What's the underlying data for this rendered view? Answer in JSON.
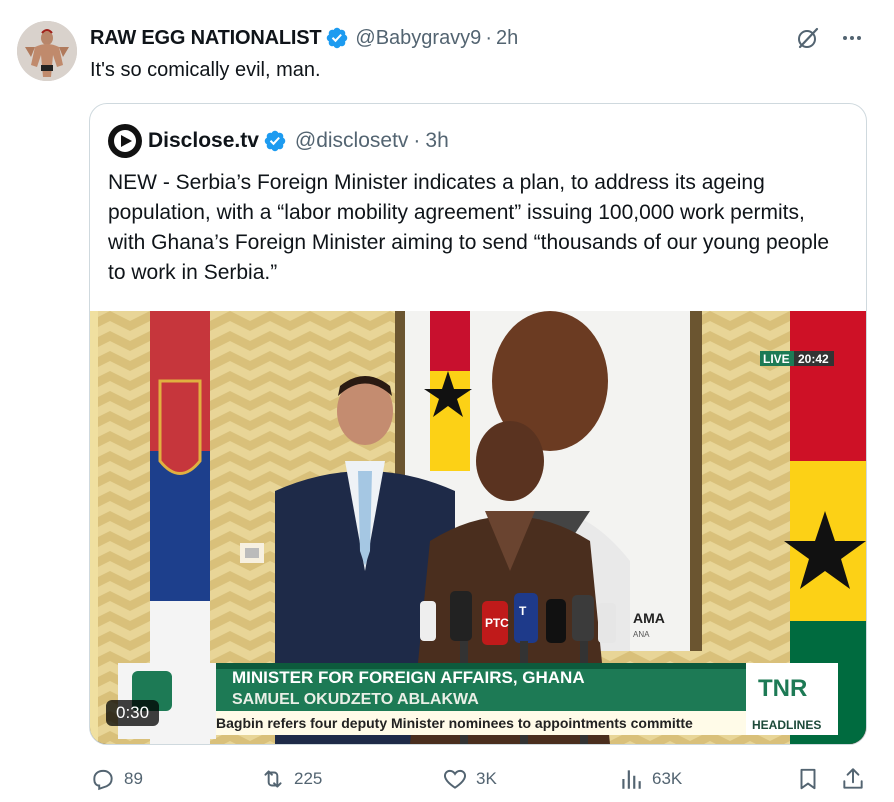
{
  "author": {
    "display_name": "RAW EGG NATIONALIST",
    "handle": "@Babygravy9",
    "separator": "·",
    "time": "2h",
    "text": "It's so comically evil, man.",
    "avatar_icon": "bodybuilder-avatar-icon",
    "verified_icon": "verified-badge-icon"
  },
  "top_actions": {
    "grok_icon": "grok-slash-icon",
    "more_icon": "more-dots-icon"
  },
  "quoted": {
    "display_name": "Disclose.tv",
    "handle": "@disclosetv",
    "separator": "·",
    "time": "3h",
    "text": "NEW - Serbia’s Foreign Minister indicates a plan, to address its ageing population, with a “labor mobility agreement” issuing 100,000 work permits, with Ghana’s Foreign Minister aiming to send “thousands of our young people to work in Serbia.”",
    "logo_icon": "disclose-tv-logo-icon"
  },
  "video": {
    "duration": "0:30",
    "live_label": "LIVE",
    "live_time": "20:42",
    "lower_third_title": "MINISTER FOR FOREIGN AFFAIRS, GHANA",
    "lower_third_name": "SAMUEL OKUDZETO ABLAKWA",
    "ticker": "Bagbin refers four deputy Minister nominees to appointments committe",
    "ticker_tag": "HEADLINES",
    "channel_logo": "TNR",
    "portrait_caption": "AMA",
    "portrait_caption_small": "ANA",
    "mic_labels": [
      "РТС",
      "T"
    ]
  },
  "actions": {
    "replies": "89",
    "reposts": "225",
    "likes": "3K",
    "views": "63K"
  },
  "colors": {
    "accent": "#1d9bf0",
    "muted": "#536471",
    "border": "#cfd9de",
    "lower_third_green": "#1d7a55"
  }
}
